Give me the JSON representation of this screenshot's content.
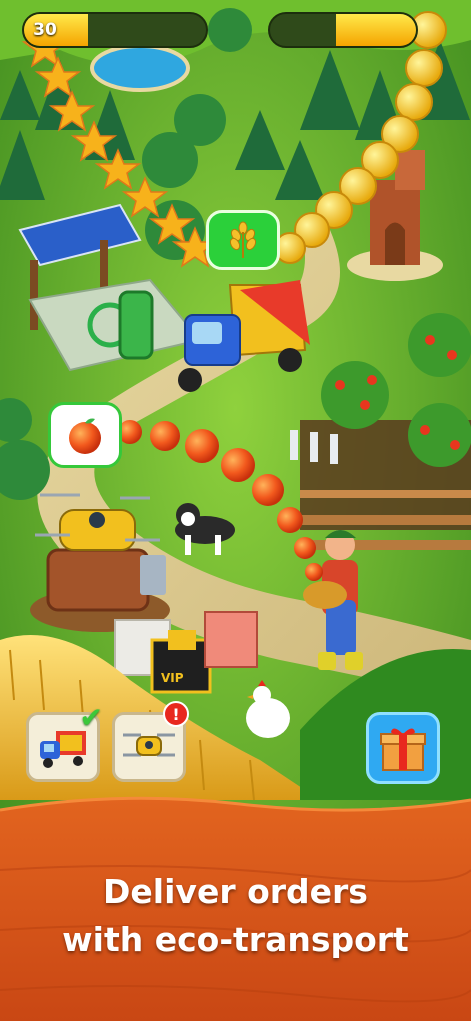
{
  "hud": {
    "level": "30",
    "xp_progress": 0.35,
    "coin_progress": 0.55
  },
  "caption": {
    "line1": "Deliver orders",
    "line2": "with eco-transport"
  },
  "order_bubbles": [
    {
      "icon": "wheat-icon",
      "color": "#2bd03a"
    },
    {
      "icon": "apple-icon",
      "color": "#ffffff"
    }
  ],
  "action_buttons": [
    {
      "icon": "delivery-truck-icon",
      "badge": "checkmark"
    },
    {
      "icon": "delivery-drone-icon",
      "badge": "alert"
    }
  ],
  "colors": {
    "banner": "#d9561a",
    "banner_dark": "#b33c0e",
    "grass": "#5fae2a",
    "star": "#f7b21b",
    "coin": "#f7d51b"
  }
}
